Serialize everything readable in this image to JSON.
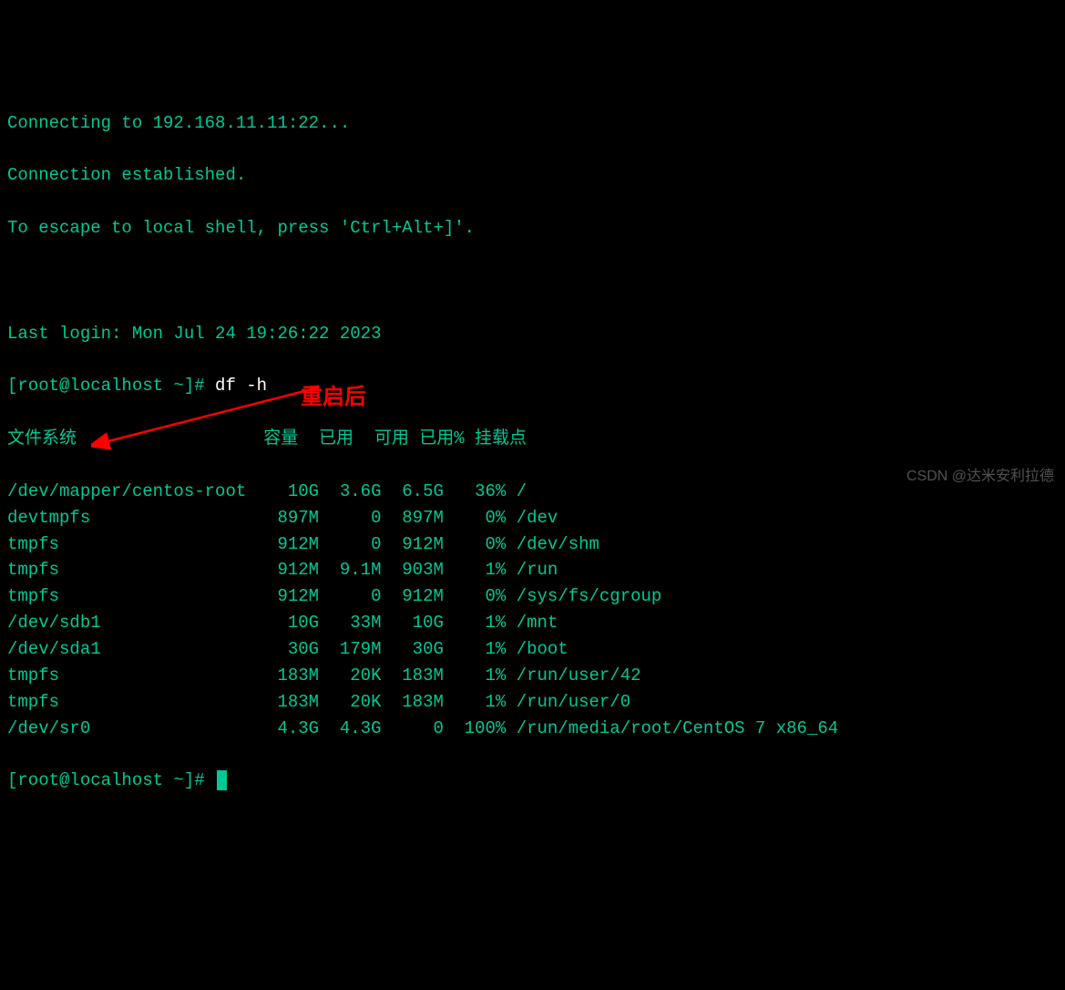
{
  "connection": {
    "line1": "Connecting to 192.168.11.11:22...",
    "line2": "Connection established.",
    "line3": "To escape to local shell, press 'Ctrl+Alt+]'."
  },
  "last_login": "Last login: Mon Jul 24 19:26:22 2023",
  "prompt1": {
    "full": "[root@localhost ~]# ",
    "command": "df -h"
  },
  "prompt2": {
    "full": "[root@localhost ~]# "
  },
  "df": {
    "header": {
      "filesystem": "文件系统",
      "size": "容量",
      "used": "已用",
      "avail": "可用",
      "usepct": "已用%",
      "mounted": "挂载点"
    },
    "rows": [
      {
        "fs": "/dev/mapper/centos-root",
        "size": "10G",
        "used": "3.6G",
        "avail": "6.5G",
        "pct": "36%",
        "mnt": "/"
      },
      {
        "fs": "devtmpfs",
        "size": "897M",
        "used": "0",
        "avail": "897M",
        "pct": "0%",
        "mnt": "/dev"
      },
      {
        "fs": "tmpfs",
        "size": "912M",
        "used": "0",
        "avail": "912M",
        "pct": "0%",
        "mnt": "/dev/shm"
      },
      {
        "fs": "tmpfs",
        "size": "912M",
        "used": "9.1M",
        "avail": "903M",
        "pct": "1%",
        "mnt": "/run"
      },
      {
        "fs": "tmpfs",
        "size": "912M",
        "used": "0",
        "avail": "912M",
        "pct": "0%",
        "mnt": "/sys/fs/cgroup"
      },
      {
        "fs": "/dev/sdb1",
        "size": "10G",
        "used": "33M",
        "avail": "10G",
        "pct": "1%",
        "mnt": "/mnt"
      },
      {
        "fs": "/dev/sda1",
        "size": "30G",
        "used": "179M",
        "avail": "30G",
        "pct": "1%",
        "mnt": "/boot"
      },
      {
        "fs": "tmpfs",
        "size": "183M",
        "used": "20K",
        "avail": "183M",
        "pct": "1%",
        "mnt": "/run/user/42"
      },
      {
        "fs": "tmpfs",
        "size": "183M",
        "used": "20K",
        "avail": "183M",
        "pct": "1%",
        "mnt": "/run/user/0"
      },
      {
        "fs": "/dev/sr0",
        "size": "4.3G",
        "used": "4.3G",
        "avail": "0",
        "pct": "100%",
        "mnt": "/run/media/root/CentOS 7 x86_64"
      }
    ]
  },
  "annotation": "重启后",
  "watermark": "CSDN @达米安利拉德"
}
